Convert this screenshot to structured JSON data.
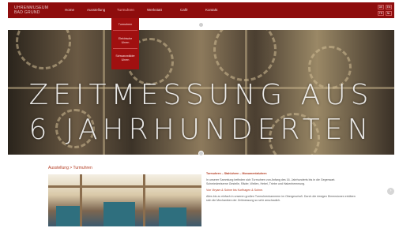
{
  "header": {
    "logo_line1": "UHRENMUSEUM",
    "logo_line2": "BAD GRUND",
    "nav": [
      "Home",
      "Ausstellung",
      "Turmuhren",
      "Werkstatt",
      "Café",
      "Kontakt"
    ],
    "active_nav": "Turmuhren",
    "languages": [
      "DE",
      "EN",
      "FR",
      "NL"
    ]
  },
  "dropdown": {
    "items": [
      "Turmuhren",
      "Elektrische Uhren",
      "Schwarzwälder Uhren"
    ]
  },
  "hero": {
    "title_line1": "ZEITMESSUNG AUS",
    "title_line2": "6 JAHRHUNDERTEN"
  },
  "content": {
    "breadcrumb": "Ausstellung > Turmuhren",
    "heading": "Turmuhren – Stahluhren – Monumentaluhren",
    "para1": "In unserer Sammlung befinden sich Turmuhren von Anfang des 16. Jahrhunderts bis in die Gegenwart. Schmiedeeiserne Gestelle, Räder, Wellen, Hebel, Triebe und Hakenhemmung.",
    "para2": "Von Viryam & Sohne bis Korfhagen & Sohne.",
    "para3": "Alles bis zu einfach in unseren großen Turmuhrenkammern im Obergeschoß. Durch die riesigen Dimensionen erklären sich die Mechaniken der Zeitmessung so sehr anschaulich."
  },
  "colors": {
    "brand": "#8e0d0d",
    "accent": "#b33a1f"
  }
}
